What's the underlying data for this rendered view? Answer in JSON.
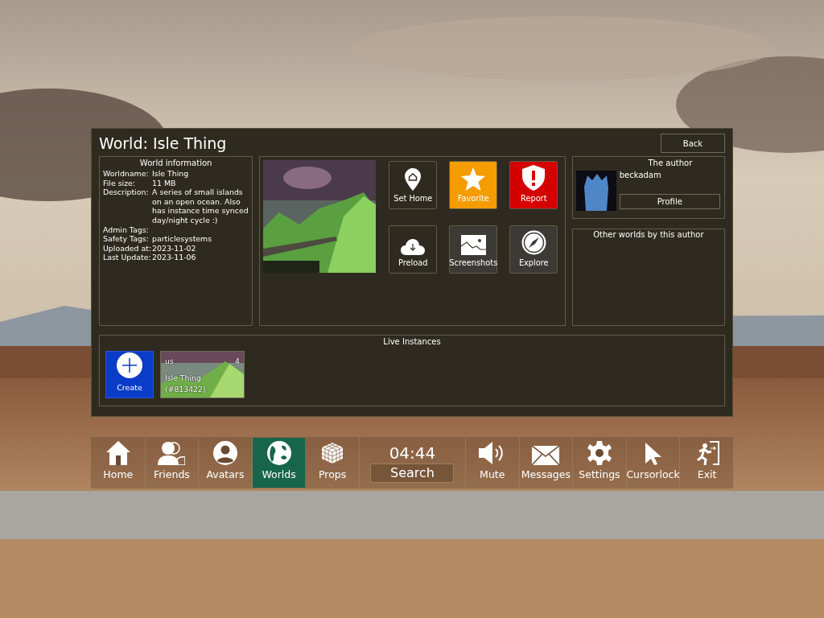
{
  "panel": {
    "title": "World: Isle Thing",
    "back_button": "Back",
    "world_information": {
      "heading": "World information",
      "rows": [
        {
          "label": "Worldname:",
          "value": "Isle Thing"
        },
        {
          "label": "File size:",
          "value": "11 MB"
        },
        {
          "label": "Description:",
          "value": "A series of small islands on an open ocean. Also has instance time synced day/night cycle :)"
        },
        {
          "label": "Admin Tags:"
        },
        {
          "label": "Safety Tags:",
          "value": "particlesystems"
        },
        {
          "label": "Uploaded at:",
          "value": "2023-11-02"
        },
        {
          "label": "Last Update:",
          "value": "2023-11-06"
        }
      ]
    },
    "actions": [
      {
        "label": "Set Home",
        "color": "#2e2a1f"
      },
      {
        "label": "Favorite",
        "color": "#f59c00"
      },
      {
        "label": "Report",
        "color": "#d50000"
      },
      {
        "label": "Preload",
        "color": "#2e2a1f"
      },
      {
        "label": "Screenshots",
        "color": "#3b3a35"
      },
      {
        "label": "Explore",
        "color": "#3b3a35"
      }
    ],
    "author": {
      "heading": "The author",
      "name": "beckadam",
      "profile_button": "Profile"
    },
    "other_worlds": {
      "heading": "Other worlds by this author"
    },
    "live_instances": {
      "heading": "Live Instances",
      "create_button": "Create",
      "instances": [
        {
          "region": "us",
          "players": "4",
          "name": "Isle Thing (#813422)"
        }
      ]
    }
  },
  "nav": {
    "items": [
      {
        "label": "Home",
        "selected": false
      },
      {
        "label": "Friends",
        "selected": false
      },
      {
        "label": "Avatars",
        "selected": false
      },
      {
        "label": "Worlds",
        "selected": true
      },
      {
        "label": "Props",
        "selected": false
      },
      {
        "kind": "clock",
        "time": "04:44",
        "search": "Search"
      },
      {
        "label": "Mute",
        "selected": false
      },
      {
        "label": "Messages",
        "selected": false
      },
      {
        "label": "Settings",
        "selected": false
      },
      {
        "label": "Cursorlock",
        "selected": false
      },
      {
        "label": "Exit",
        "selected": false
      }
    ]
  }
}
